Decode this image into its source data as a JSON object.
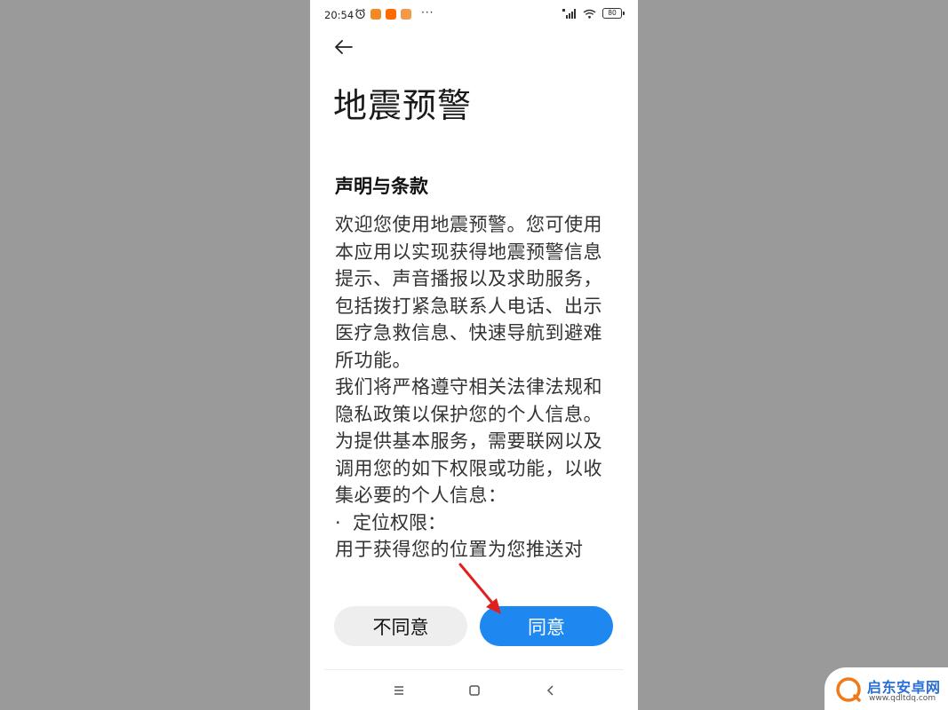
{
  "status_bar": {
    "time": "20:54",
    "more": "···",
    "battery": "80",
    "icons": [
      "alarm-icon",
      "app-notification-icon",
      "mi-icon",
      "app-notification-icon",
      "signal-icon",
      "wifi-icon",
      "battery-icon"
    ]
  },
  "header": {
    "title": "地震预警"
  },
  "terms": {
    "section_title": "声明与条款",
    "paragraphs": [
      "欢迎您使用地震预警。您可使用本应用以实现获得地震预警信息提示、声音播报以及求助服务，包括拨打紧急联系人电话、出示医疗急救信息、快速导航到避难所功能。",
      "我们将严格遵守相关法律法规和隐私政策以保护您的个人信息。",
      "为提供基本服务，需要联网以及调用您的如下权限或功能，以收集必要的个人信息：",
      "·  定位权限：",
      "用于获得您的位置为您推送对"
    ]
  },
  "buttons": {
    "disagree": "不同意",
    "agree": "同意"
  },
  "watermark": {
    "name": "启东安卓网",
    "url": "www.qdltdq.com"
  },
  "colors": {
    "accent": "#1e88f0",
    "disagree_bg": "#eeeeee",
    "arrow": "#e02020"
  }
}
